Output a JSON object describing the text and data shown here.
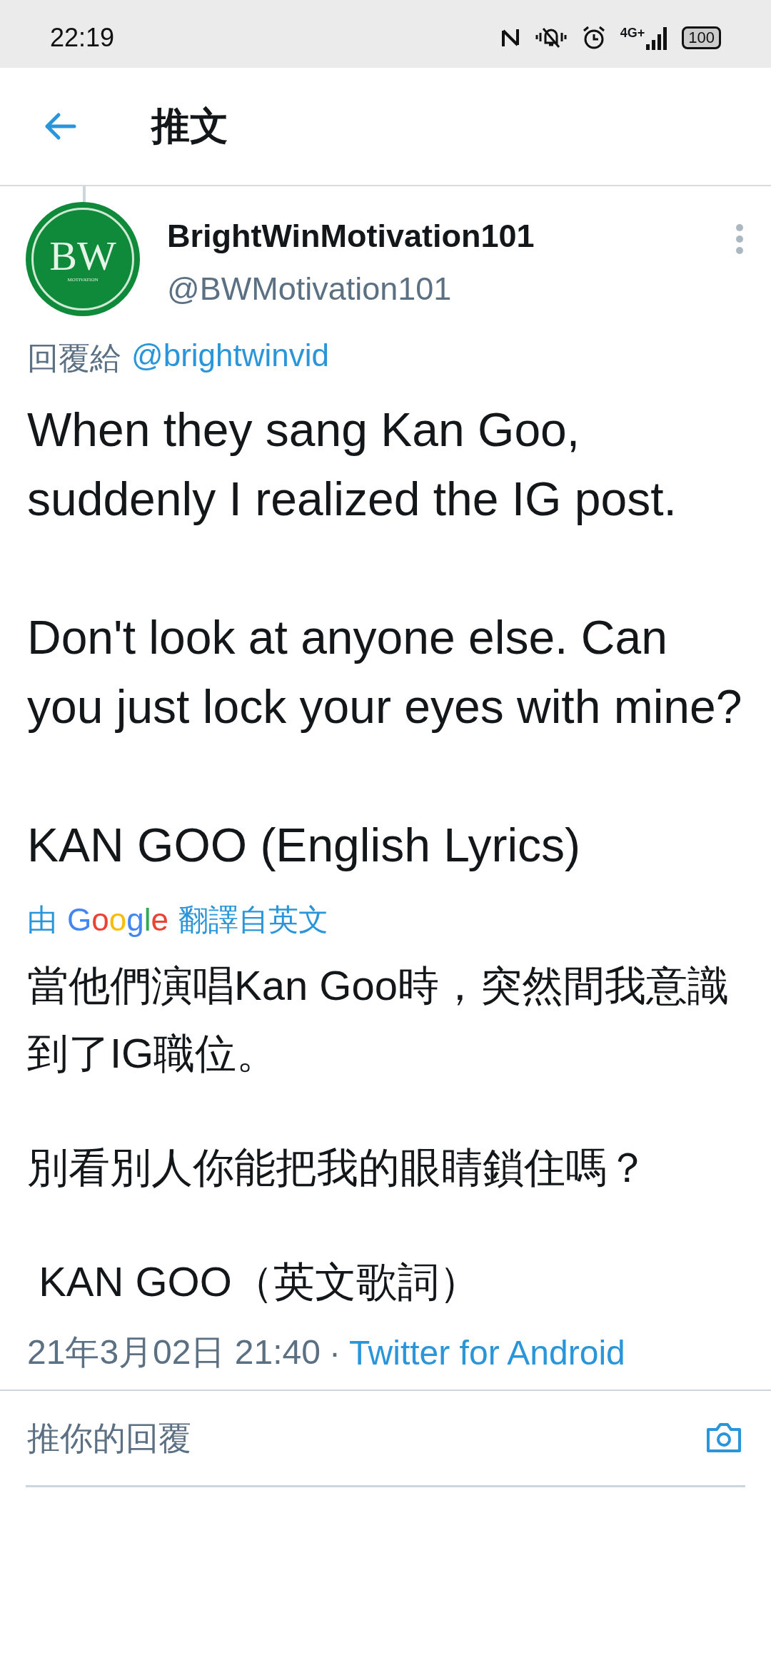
{
  "status_bar": {
    "time": "22:19",
    "battery": "100",
    "network": "4G+"
  },
  "header": {
    "title": "推文"
  },
  "tweet": {
    "avatar": {
      "initials": "BW",
      "tagline": "MOTIVATION"
    },
    "name": "BrightWinMotivation101",
    "handle": "@BWMotivation101",
    "reply_label": "回覆給",
    "reply_to": "@brightwinvid",
    "paragraphs": [
      "When they sang Kan Goo, suddenly I realized the IG post.",
      "Don't look at anyone else. Can you just lock your eyes with mine?",
      "KAN GOO (English Lyrics)"
    ],
    "translation": {
      "prefix": "由",
      "brand": "Google",
      "suffix": "翻譯自英文"
    },
    "translated_paragraphs": [
      "當他們演唱Kan Goo時，突然間我意識到了IG職位。",
      "別看別人你能把我的眼睛鎖住嗎？",
      " KAN GOO（英文歌詞）"
    ],
    "timestamp": "21年3月02日 21:40",
    "separator": "·",
    "source": "Twitter for Android"
  },
  "reply_field": {
    "placeholder": "推你的回覆"
  }
}
